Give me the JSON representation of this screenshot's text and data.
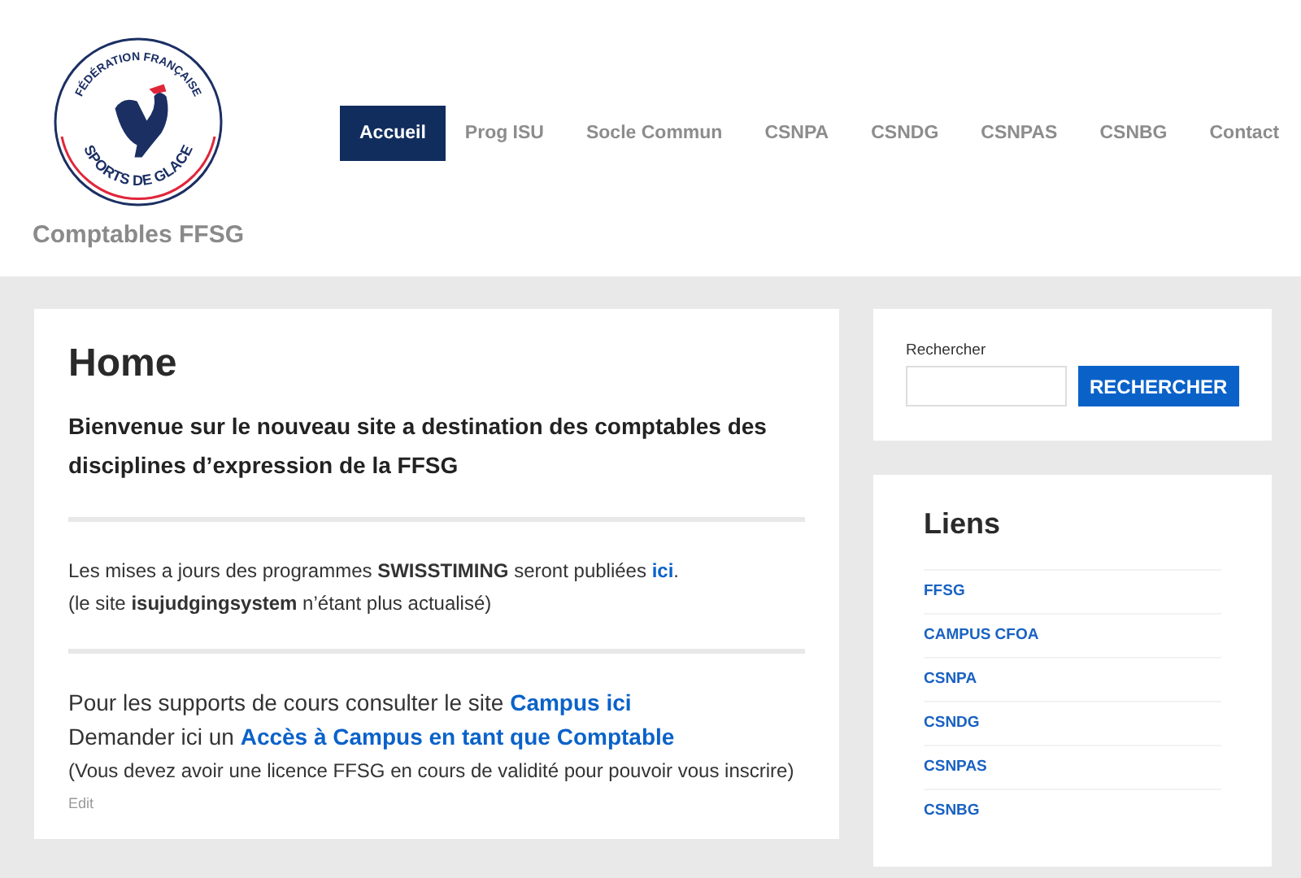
{
  "logo": {
    "top_text": "FÉDÉRATION FRANÇAISE",
    "bottom_text": "SPORTS DE GLACE"
  },
  "site_title": "Comptables FFSG",
  "nav": [
    {
      "label": "Accueil",
      "selected": true
    },
    {
      "label": "Prog ISU",
      "selected": false
    },
    {
      "label": "Socle Commun",
      "selected": false
    },
    {
      "label": "CSNPA",
      "selected": false
    },
    {
      "label": "CSNDG",
      "selected": false
    },
    {
      "label": "CSNPAS",
      "selected": false
    },
    {
      "label": "CSNBG",
      "selected": false
    },
    {
      "label": "Contact",
      "selected": false
    }
  ],
  "main": {
    "title": "Home",
    "intro": "Bienvenue sur le nouveau site a destination des comptables des disciplines d’expression de la FFSG",
    "sections": [
      {
        "kind": "notice",
        "paragraphs": [
          [
            {
              "kind": "plain",
              "text": "Les mises a jours des programmes "
            },
            {
              "kind": "bold",
              "text": "SWISSTIMING"
            },
            {
              "kind": "plain",
              "text": " seront publiées "
            },
            {
              "kind": "link",
              "text": "ici"
            },
            {
              "kind": "plain",
              "text": "."
            }
          ],
          [
            {
              "kind": "plain",
              "text": "(le site "
            },
            {
              "kind": "bold",
              "text": "isujudgingsystem"
            },
            {
              "kind": "plain",
              "text": " n’étant plus actualisé)"
            }
          ]
        ]
      },
      {
        "kind": "courses",
        "paragraphs": [
          [
            {
              "kind": "plain",
              "text": "Pour les supports de cours consulter le site "
            },
            {
              "kind": "link",
              "text": "Campus ici"
            }
          ],
          [
            {
              "kind": "plain",
              "text": "Demander ici un "
            },
            {
              "kind": "link",
              "text": "Accès à Campus en tant que Comptable"
            }
          ],
          [
            {
              "kind": "plain",
              "text": "(Vous devez avoir une licence FFSG en cours de validité pour pouvoir vous inscrire)"
            }
          ]
        ]
      }
    ],
    "edit": "Edit"
  },
  "search": {
    "label": "Rechercher",
    "button": "RECHERCHER"
  },
  "links": {
    "title": "Liens",
    "items": [
      "FFSG",
      "CAMPUS CFOA",
      "CSNPA",
      "CSNDG",
      "CSNPAS",
      "CSNBG"
    ]
  }
}
